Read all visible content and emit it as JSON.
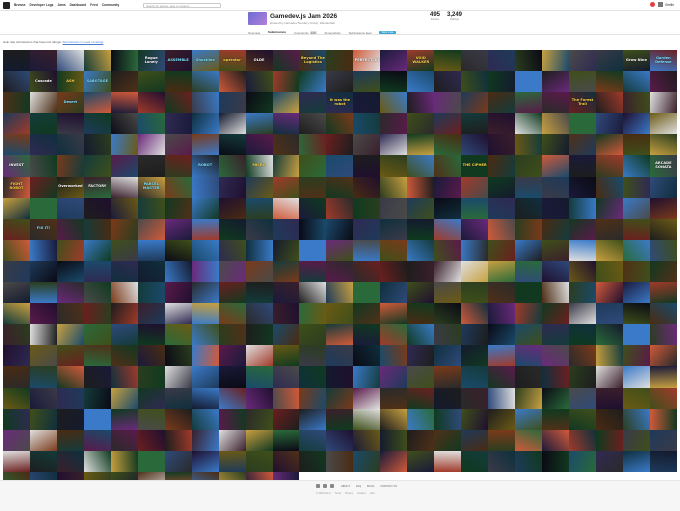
{
  "nav": {
    "items": [
      "Browse",
      "Developer Logs",
      "Jams",
      "Dashboard",
      "Feed",
      "Community"
    ],
    "search_placeholder": "Search for games, tags or creators",
    "username": "Emilie"
  },
  "jam": {
    "title": "Gamedev.js Jam 2026",
    "host": "Hosted by Gamedev Nerdery Group, Wanderfalk",
    "stats": [
      {
        "value": "495",
        "label": "Entries"
      },
      {
        "value": "3,249",
        "label": "Ratings"
      }
    ],
    "tabs": [
      {
        "label": "Overview"
      },
      {
        "label": "Submissions",
        "active": true
      },
      {
        "label": "Community",
        "count": "120"
      },
      {
        "label": "Screenshots"
      },
      {
        "label": "Submissions feed"
      }
    ],
    "badge": "View more"
  },
  "note": {
    "text": "Help rate submissions that have low ratings:",
    "link": "Submissions in need of ratings"
  },
  "tiles": [
    "",
    "",
    "",
    "",
    "",
    "Rogue Lonely",
    "ASSEMBLE",
    "Ghostline",
    "operator",
    "OLDE",
    "",
    "Beyond The Logistics",
    "",
    "PERFECT 3D",
    "",
    "VOID WALKER",
    "",
    "",
    "",
    "",
    "",
    "",
    "",
    "Grow Nine",
    "Garden Defense",
    "",
    "Cascade",
    "ASH",
    "SABOTAGE",
    "",
    "",
    "",
    "",
    "",
    "",
    "",
    "",
    "",
    "",
    "",
    "",
    "",
    "",
    "",
    "",
    "",
    "",
    "",
    "",
    "",
    "",
    "",
    "Desert",
    "",
    "",
    "",
    "",
    "",
    "",
    "",
    "",
    "",
    "It was the robot",
    "",
    "",
    "",
    "",
    "",
    "",
    "",
    "",
    "The Forest Trail",
    "",
    "",
    "",
    "",
    "",
    "",
    "",
    "",
    "",
    "",
    "",
    "",
    "",
    "",
    "",
    "",
    "",
    "",
    "",
    "",
    "",
    "",
    "",
    "",
    "",
    "",
    "",
    "",
    "",
    "",
    "",
    "",
    "",
    "",
    "",
    "",
    "",
    "",
    "",
    "",
    "",
    "",
    "",
    "",
    "",
    "",
    "",
    "",
    "",
    "",
    "",
    "",
    "",
    "INVEST",
    "",
    "",
    "",
    "",
    "",
    "",
    "ROBOT",
    "",
    "MICRO",
    "",
    "",
    "",
    "",
    "",
    "",
    "",
    "THE CIPHER",
    "",
    "",
    "",
    "",
    "",
    "",
    "ARCADE SONATA",
    "FIGHT ROBOT",
    "",
    "Overworked",
    "FACTORY",
    "",
    "PARCEL MASTER",
    "",
    "",
    "",
    "",
    "",
    "",
    "",
    "",
    "",
    "",
    "",
    "",
    "",
    "",
    "",
    "",
    "",
    "",
    "",
    "",
    "",
    "",
    "",
    "",
    "",
    "",
    "",
    "",
    "",
    "",
    "",
    "",
    "",
    "",
    "",
    "",
    "",
    "",
    "",
    "",
    "",
    "",
    "",
    "",
    "",
    "FIX IT!",
    "",
    "",
    "",
    "",
    "",
    "",
    "",
    "",
    "",
    "",
    "",
    "",
    "",
    "",
    "",
    "",
    "",
    "",
    "",
    "",
    "",
    "",
    "",
    "",
    "",
    "",
    "",
    "",
    "",
    "",
    "",
    "",
    "",
    "",
    "",
    "",
    "",
    "",
    "",
    "",
    "",
    "",
    "",
    "",
    "",
    "",
    "",
    "",
    "",
    "",
    "",
    "",
    "",
    "",
    "",
    "",
    "",
    "",
    "",
    "",
    "",
    "",
    "",
    "",
    "",
    "",
    "",
    "",
    "",
    "",
    "",
    "",
    "",
    "",
    "",
    "",
    "",
    "",
    "",
    "",
    "",
    "",
    "",
    "",
    "",
    "",
    "",
    "",
    "",
    "",
    "",
    "",
    "",
    "",
    "",
    "",
    "",
    "",
    "",
    "",
    "",
    "",
    "",
    "",
    "",
    "",
    "",
    "",
    "",
    "",
    "",
    "",
    "",
    "",
    "",
    "",
    "",
    "",
    "",
    "",
    "",
    "",
    "",
    "",
    "",
    "",
    "",
    "",
    "",
    "",
    "",
    "",
    "",
    "",
    "",
    "",
    "",
    "",
    "",
    "",
    "",
    "",
    "",
    "",
    "",
    "",
    "",
    "",
    "",
    "",
    "",
    "",
    "",
    "",
    "",
    "",
    "",
    "",
    "",
    "",
    "",
    "",
    "",
    "",
    "",
    "",
    "",
    "",
    "",
    "",
    "",
    "",
    "",
    "",
    "",
    "",
    "",
    "",
    "",
    "",
    "",
    "",
    "",
    "",
    "",
    "",
    "",
    "",
    "",
    "",
    "",
    "",
    "",
    "",
    "",
    "",
    "",
    "",
    "",
    "",
    "",
    "",
    "",
    "",
    "",
    "",
    "",
    "",
    "",
    "",
    "",
    "",
    "",
    "",
    "",
    "",
    "",
    "",
    "",
    "",
    "",
    "",
    "",
    "",
    "",
    "",
    "",
    "",
    "",
    "",
    "",
    "",
    "",
    "",
    "",
    "",
    "",
    "",
    "",
    "",
    "",
    "",
    "",
    "",
    "",
    "",
    "",
    "",
    "",
    "",
    "",
    "",
    "",
    "",
    "",
    "",
    "",
    "",
    "",
    "",
    "",
    "",
    "",
    "",
    "",
    "",
    "",
    "",
    "",
    "",
    "",
    "",
    "",
    "",
    "",
    "",
    "",
    "",
    "",
    "",
    "",
    "",
    "",
    "",
    "",
    "",
    "",
    "",
    "",
    "",
    "",
    "",
    "",
    "",
    "",
    "",
    "",
    "",
    "",
    "",
    "",
    "",
    "",
    "",
    "",
    "",
    "",
    "",
    "",
    "",
    "",
    "",
    "",
    "",
    "",
    "",
    "",
    "",
    "",
    "",
    "",
    "",
    ""
  ],
  "footer": {
    "links": [
      "ABOUT",
      "FAQ",
      "BLOG",
      "CONTACT US"
    ],
    "copyright": "© 2026 itch.io",
    "mini": [
      "Terms",
      "Privacy",
      "Cookies",
      "Jobs"
    ]
  }
}
